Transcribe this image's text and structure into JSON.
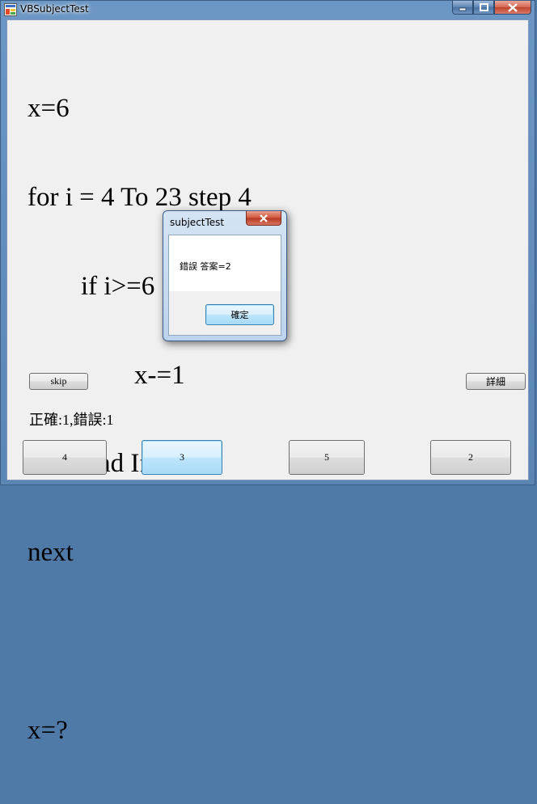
{
  "window": {
    "title": "VBSubjectTest",
    "colors": {
      "accent": "#3c7fb1",
      "close": "#c0442c"
    }
  },
  "caption_buttons": {
    "minimize_icon": "minimize-icon",
    "maximize_icon": "maximize-icon",
    "close_icon": "close-icon"
  },
  "question": {
    "lines": [
      "x=6",
      "for i = 4 To 23 step 4",
      "        if i>=6",
      "                x-=1",
      "        End If",
      "next",
      "",
      "x=?"
    ]
  },
  "controls": {
    "skip_label": "skip",
    "detail_label": "詳細"
  },
  "score_text": "正確:1,錯誤:1",
  "answers": [
    "4",
    "3",
    "5",
    "2"
  ],
  "dialog": {
    "title": "subjectTest",
    "message": "錯誤 答案=2",
    "ok_label": "確定"
  }
}
